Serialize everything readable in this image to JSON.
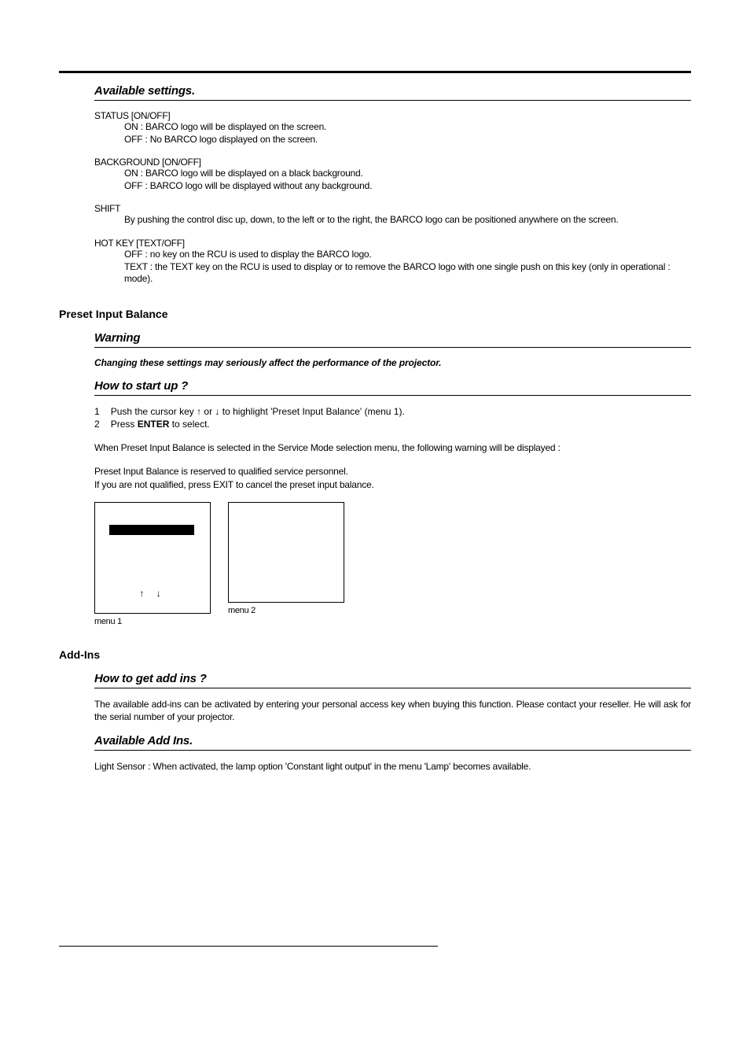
{
  "sections": {
    "available_settings": {
      "title": "Available settings.",
      "status": {
        "label": "STATUS [ON/OFF]",
        "on": "ON : BARCO logo will be displayed on the screen.",
        "off": "OFF : No BARCO logo displayed on the screen."
      },
      "background": {
        "label": "BACKGROUND [ON/OFF]",
        "on": "ON : BARCO logo will be displayed on a black background.",
        "off": "OFF : BARCO logo will be displayed without any background."
      },
      "shift": {
        "label": "SHIFT",
        "desc": "By pushing the control disc up, down, to the left or to the right, the BARCO logo can be positioned anywhere on the screen."
      },
      "hotkey": {
        "label": "HOT KEY [TEXT/OFF]",
        "off": "OFF : no key on the RCU is used to display the BARCO logo.",
        "text": "TEXT : the TEXT key on the RCU is used to display or to remove the BARCO logo with one single push on this key (only in operational : mode)."
      }
    },
    "preset": {
      "heading": "Preset Input Balance",
      "warning_title": "Warning",
      "warning_text": "Changing these settings may seriously affect the performance of the projector.",
      "howto_title": "How to start up ?",
      "step1_pre": "Push the cursor key ",
      "step1_mid": " or ",
      "step1_post": " to highlight 'Preset Input Balance' (menu 1).",
      "step2_pre": "Press ",
      "step2_bold": "ENTER",
      "step2_post": " to select.",
      "para1": "When Preset Input Balance is selected in the Service Mode selection menu, the following warning will be displayed :",
      "para2a": "Preset Input Balance is reserved to qualified service personnel.",
      "para2b": "If you are not qualified, press EXIT to cancel the preset input balance.",
      "menu1_caption": "menu 1",
      "menu2_caption": "menu 2",
      "arrows": "↑   ↓"
    },
    "addins": {
      "heading": "Add-Ins",
      "howto_title": "How to get add ins ?",
      "howto_text": "The available add-ins can be activated by entering your personal access key when buying this function.  Please contact your reseller. He will ask for the serial number of your projector.",
      "available_title": "Available Add Ins.",
      "available_text": "Light Sensor : When activated, the lamp option 'Constant light output' in the menu 'Lamp' becomes available."
    }
  },
  "glyphs": {
    "up": "↑",
    "down": "↓"
  },
  "list_numbers": {
    "one": "1",
    "two": "2"
  }
}
